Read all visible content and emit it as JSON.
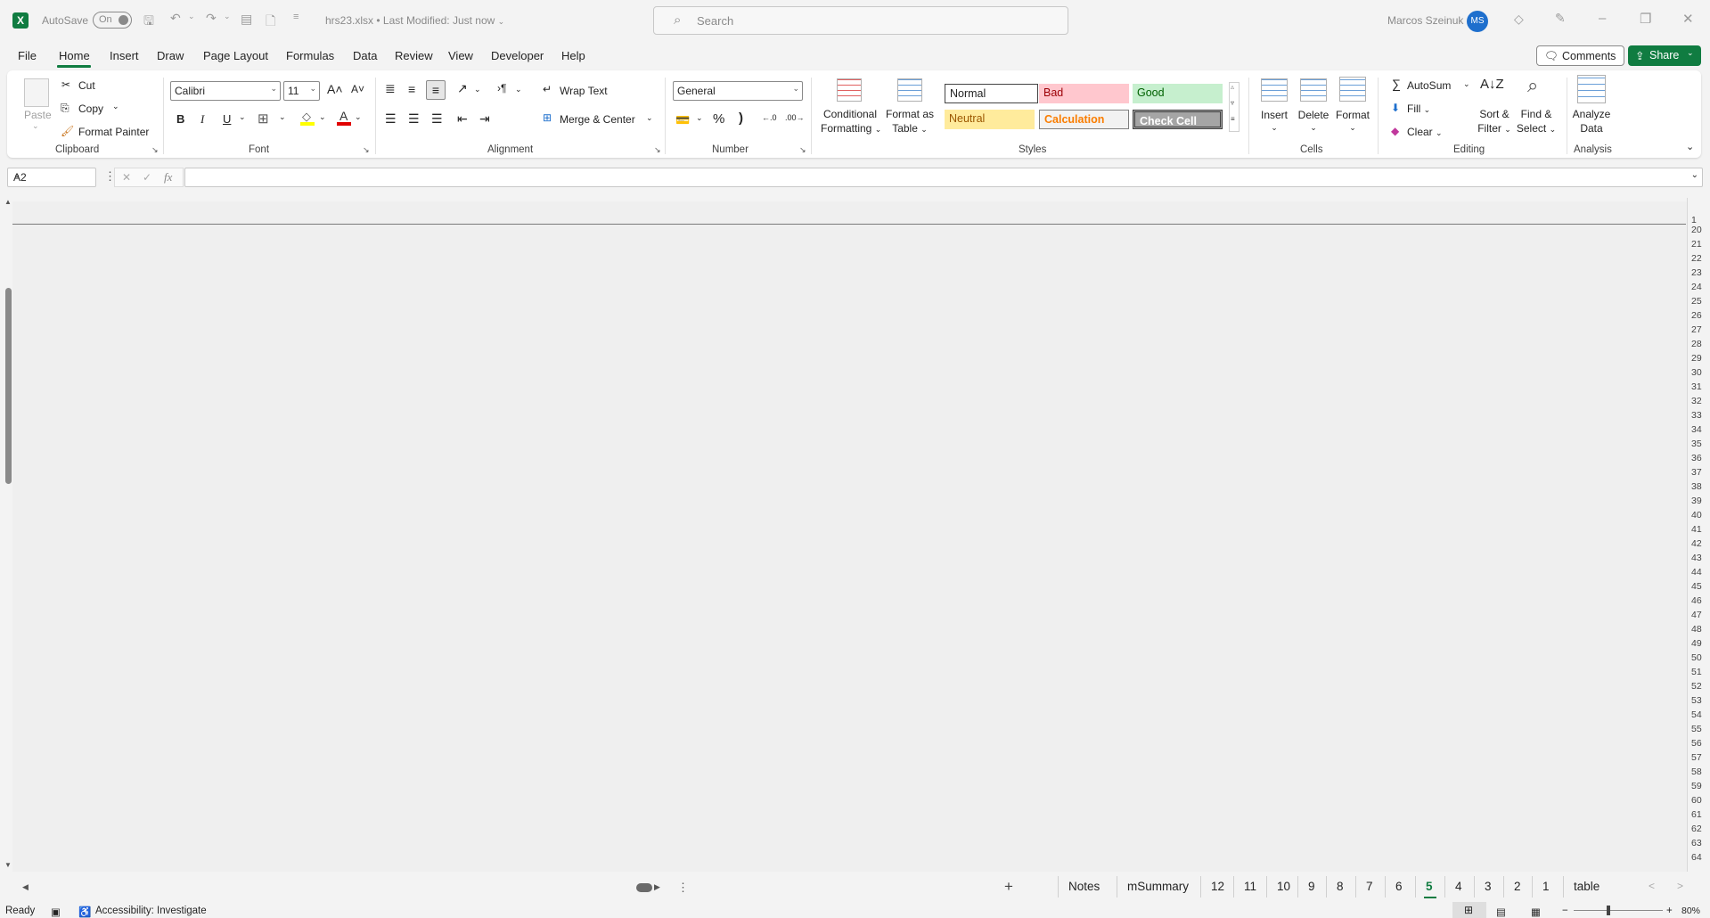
{
  "titlebar": {
    "autosave_label": "AutoSave",
    "autosave_state": "On",
    "filename": "hrs23.xlsx",
    "separator": "•",
    "last_modified": "Last Modified: Just now",
    "search_placeholder": "Search",
    "user_name": "Marcos Szeinuk",
    "user_initials": "MS"
  },
  "menu": {
    "tabs": [
      "File",
      "Home",
      "Insert",
      "Draw",
      "Page Layout",
      "Formulas",
      "Data",
      "Review",
      "View",
      "Developer",
      "Help"
    ],
    "active": "Home",
    "comments": "Comments",
    "share": "Share"
  },
  "ribbon": {
    "clipboard": {
      "paste": "Paste",
      "cut": "Cut",
      "copy": "Copy",
      "format_painter": "Format Painter",
      "label": "Clipboard"
    },
    "font": {
      "name": "Calibri",
      "size": "11",
      "bold": "B",
      "italic": "I",
      "underline": "U",
      "label": "Font"
    },
    "alignment": {
      "wrap_text": "Wrap Text",
      "merge_center": "Merge & Center",
      "label": "Alignment"
    },
    "number": {
      "format": "General",
      "label": "Number"
    },
    "styles": {
      "conditional": [
        "Conditional",
        "Formatting"
      ],
      "format_as_table": [
        "Format as",
        "Table"
      ],
      "normal": "Normal",
      "bad": "Bad",
      "good": "Good",
      "neutral": "Neutral",
      "calculation": "Calculation",
      "check_cell": "Check Cell",
      "label": "Styles"
    },
    "cells": {
      "insert": "Insert",
      "delete": "Delete",
      "format": "Format",
      "label": "Cells"
    },
    "editing": {
      "autosum": "AutoSum",
      "fill": "Fill",
      "clear": "Clear",
      "sort_filter": [
        "Sort &",
        "Filter"
      ],
      "find_select": [
        "Find &",
        "Select"
      ],
      "label": "Editing"
    },
    "analysis": {
      "analyze_data": [
        "Analyze",
        "Data"
      ],
      "label": "Analysis"
    }
  },
  "formula_bar": {
    "name_box": "A2",
    "formula": ""
  },
  "rows": [
    "1",
    "20",
    "21",
    "22",
    "23",
    "24",
    "25",
    "26",
    "27",
    "28",
    "29",
    "30",
    "31",
    "32",
    "33",
    "34",
    "35",
    "36",
    "37",
    "38",
    "39",
    "40",
    "41",
    "42",
    "43",
    "44",
    "45",
    "46",
    "47",
    "48",
    "49",
    "50",
    "51",
    "52",
    "53",
    "54",
    "55",
    "56",
    "57",
    "58",
    "59",
    "60",
    "61",
    "62",
    "63",
    "64"
  ],
  "sheet_tabs": [
    "Notes",
    "mSummary",
    "12",
    "11",
    "10",
    "9",
    "8",
    "7",
    "6",
    "5",
    "4",
    "3",
    "2",
    "1",
    "table"
  ],
  "active_sheet": "5",
  "status": {
    "ready": "Ready",
    "accessibility": "Accessibility: Investigate",
    "zoom": "80%"
  },
  "colors": {
    "excel_green": "#107c41",
    "avatar_blue": "#1e6fcd"
  }
}
